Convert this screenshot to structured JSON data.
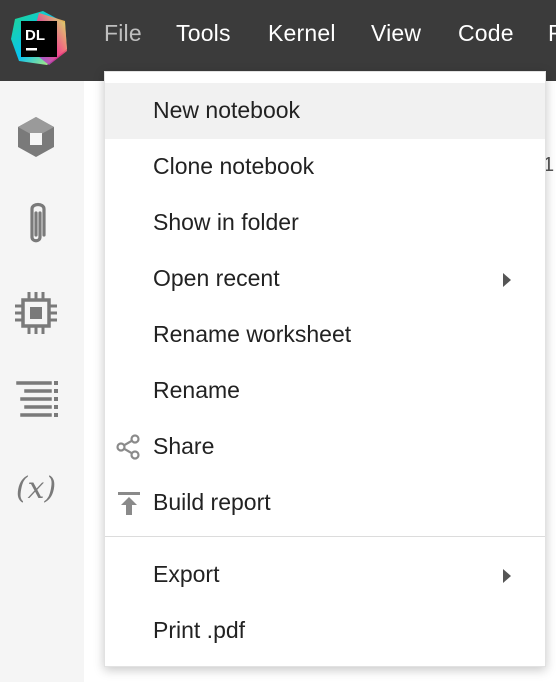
{
  "app": {
    "logo_text": "DL"
  },
  "menubar": {
    "items": [
      {
        "label": "File"
      },
      {
        "label": "Tools"
      },
      {
        "label": "Kernel"
      },
      {
        "label": "View"
      },
      {
        "label": "Code"
      },
      {
        "label": "F"
      }
    ]
  },
  "sidebar": {
    "icons": [
      "cube-icon",
      "paperclip-icon",
      "chip-icon",
      "text-align-icon",
      "variables-icon"
    ],
    "variables_label": "(x)"
  },
  "background": {
    "fragment": "1"
  },
  "file_menu": {
    "items": [
      {
        "label": "New notebook"
      },
      {
        "label": "Clone notebook"
      },
      {
        "label": "Show in folder"
      },
      {
        "label": "Open recent"
      },
      {
        "label": "Rename worksheet"
      },
      {
        "label": "Rename"
      },
      {
        "label": "Share"
      },
      {
        "label": "Build report"
      },
      {
        "label": "Export"
      },
      {
        "label": "Print .pdf"
      }
    ]
  },
  "colors": {
    "topbar": "#3b3b3b",
    "menu_active": "#bfbfbf",
    "hover": "#f1f1f1",
    "icon": "#7a7a7a"
  }
}
